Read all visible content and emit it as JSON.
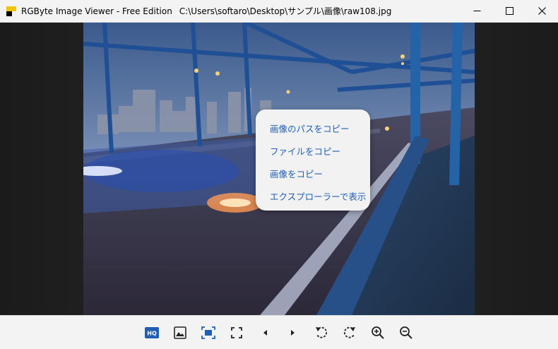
{
  "window": {
    "app_title": "RGByte Image Viewer - Free Edition",
    "file_path": "C:\\Users\\softaro\\Desktop\\サンプル\\画像\\raw108.jpg"
  },
  "context_menu": {
    "items": [
      {
        "label": "画像のパスをコピー"
      },
      {
        "label": "ファイルをコピー"
      },
      {
        "label": "画像をコピー"
      },
      {
        "label": "エクスプローラーで表示"
      }
    ]
  },
  "toolbar": {
    "hq_label": "HQ",
    "icons": [
      "hq-icon",
      "image-icon",
      "fit-icon",
      "fullscreen-icon",
      "previous-icon",
      "next-icon",
      "rotate-left-icon",
      "rotate-right-icon",
      "zoom-in-icon",
      "zoom-out-icon"
    ]
  },
  "colors": {
    "accent": "#1f5fb4",
    "titlebar": "#f3f3f3",
    "menu_text": "#1f5fb4"
  }
}
